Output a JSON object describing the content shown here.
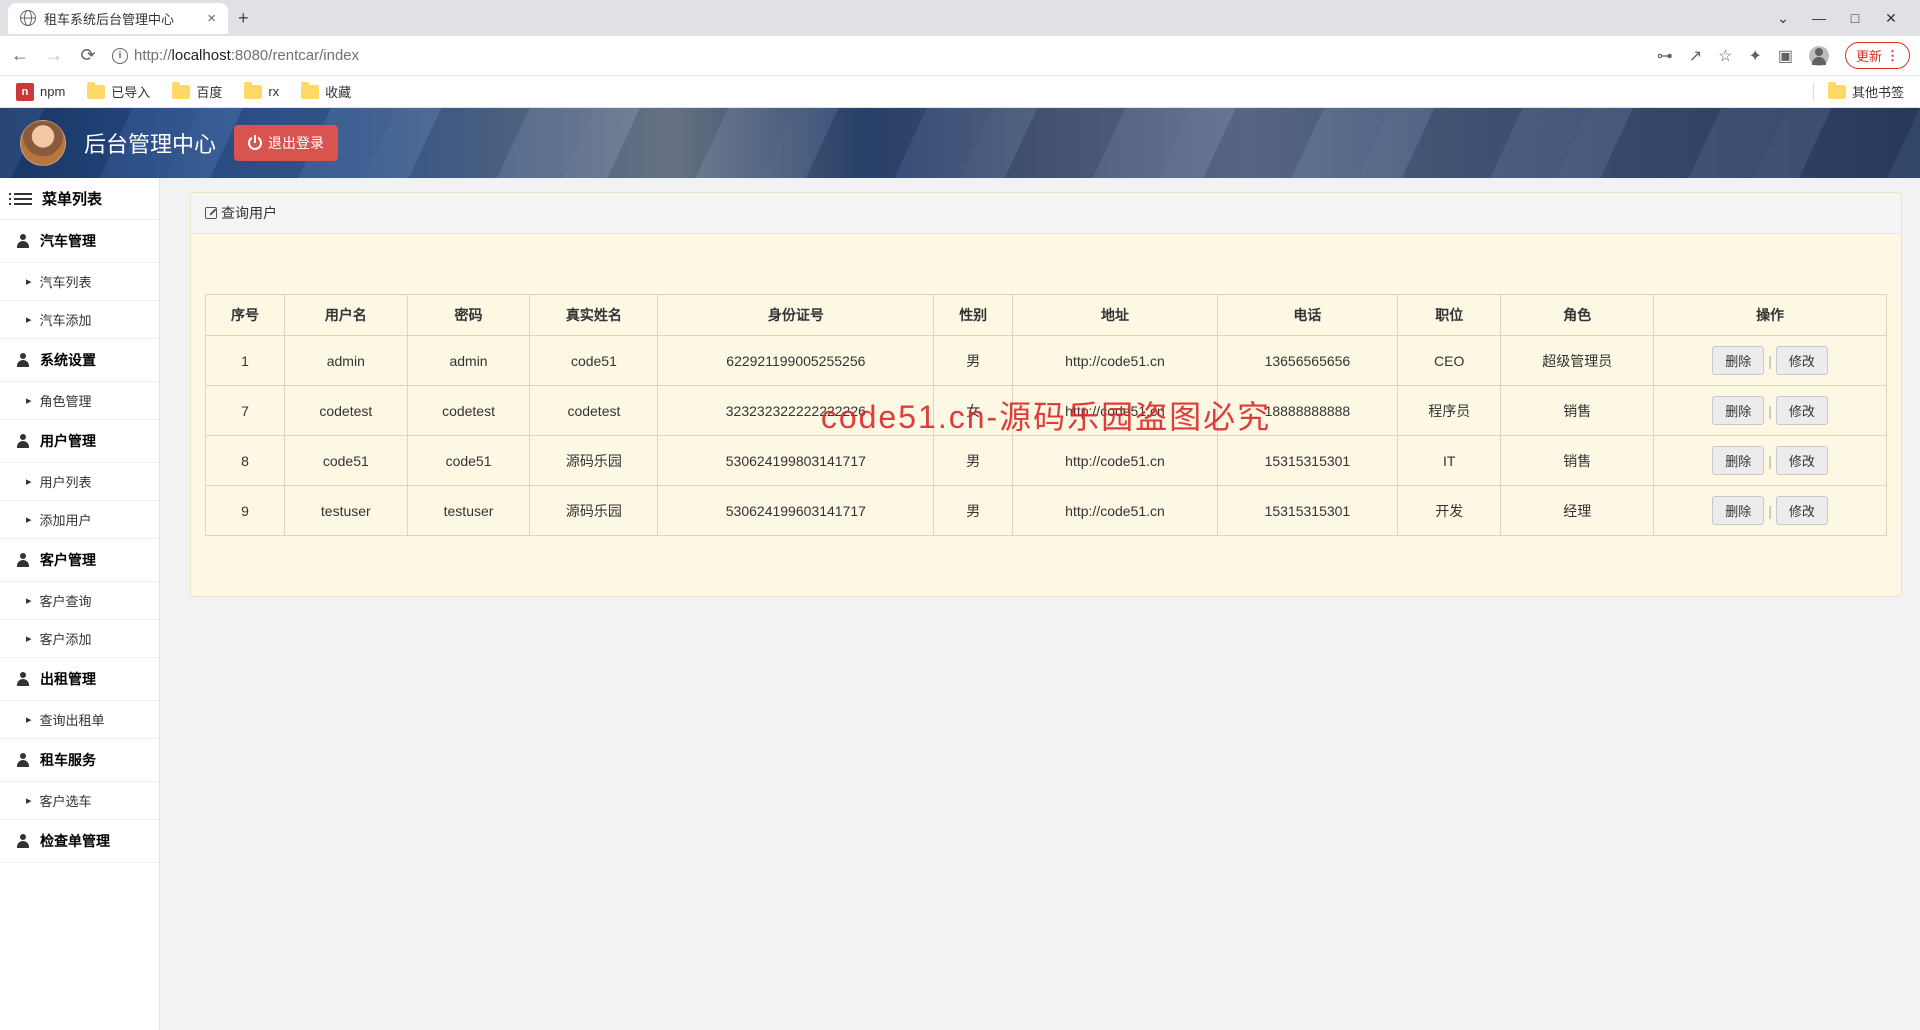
{
  "browser": {
    "tab_title": "租车系统后台管理中心",
    "new_tab": "+",
    "url_host_pre": "http://",
    "url_host": "localhost",
    "url_port_path": ":8080/rentcar/index",
    "update_label": "更新",
    "win": {
      "min": "—",
      "max": "□",
      "close": "✕",
      "chev": "⌄"
    },
    "addr_icons": {
      "key": "⊶",
      "share": "↗",
      "star": "☆",
      "ext": "✦",
      "panel": "▣"
    }
  },
  "bookmarks": {
    "items": [
      "npm",
      "已导入",
      "百度",
      "rx",
      "收藏"
    ],
    "other": "其他书签"
  },
  "header": {
    "title": "后台管理中心",
    "logout": "退出登录"
  },
  "sidebar": {
    "header": "菜单列表",
    "groups": [
      {
        "label": "汽车管理",
        "items": [
          "汽车列表",
          "汽车添加"
        ]
      },
      {
        "label": "系统设置",
        "items": [
          "角色管理"
        ]
      },
      {
        "label": "用户管理",
        "items": [
          "用户列表",
          "添加用户"
        ]
      },
      {
        "label": "客户管理",
        "items": [
          "客户查询",
          "客户添加"
        ]
      },
      {
        "label": "出租管理",
        "items": [
          "查询出租单"
        ]
      },
      {
        "label": "租车服务",
        "items": [
          "客户选车"
        ]
      },
      {
        "label": "检查单管理",
        "items": []
      }
    ]
  },
  "panel": {
    "title": "查询用户",
    "watermark": "code51.cn-源码乐园盗图必究"
  },
  "table": {
    "headers": [
      "序号",
      "用户名",
      "密码",
      "真实姓名",
      "身份证号",
      "性别",
      "地址",
      "电话",
      "职位",
      "角色",
      "操作"
    ],
    "action_delete": "删除",
    "action_edit": "修改",
    "rows": [
      {
        "id": "1",
        "user": "admin",
        "pwd": "admin",
        "name": "code51",
        "idcard": "622921199005255256",
        "sex": "男",
        "addr": "http://code51.cn",
        "tel": "13656565656",
        "pos": "CEO",
        "role": "超级管理员"
      },
      {
        "id": "7",
        "user": "codetest",
        "pwd": "codetest",
        "name": "codetest",
        "idcard": "323232322222222226",
        "sex": "女",
        "addr": "http://code51.cn",
        "tel": "18888888888",
        "pos": "程序员",
        "role": "销售"
      },
      {
        "id": "8",
        "user": "code51",
        "pwd": "code51",
        "name": "源码乐园",
        "idcard": "530624199803141717",
        "sex": "男",
        "addr": "http://code51.cn",
        "tel": "15315315301",
        "pos": "IT",
        "role": "销售"
      },
      {
        "id": "9",
        "user": "testuser",
        "pwd": "testuser",
        "name": "源码乐园",
        "idcard": "530624199603141717",
        "sex": "男",
        "addr": "http://code51.cn",
        "tel": "15315315301",
        "pos": "开发",
        "role": "经理"
      }
    ]
  }
}
